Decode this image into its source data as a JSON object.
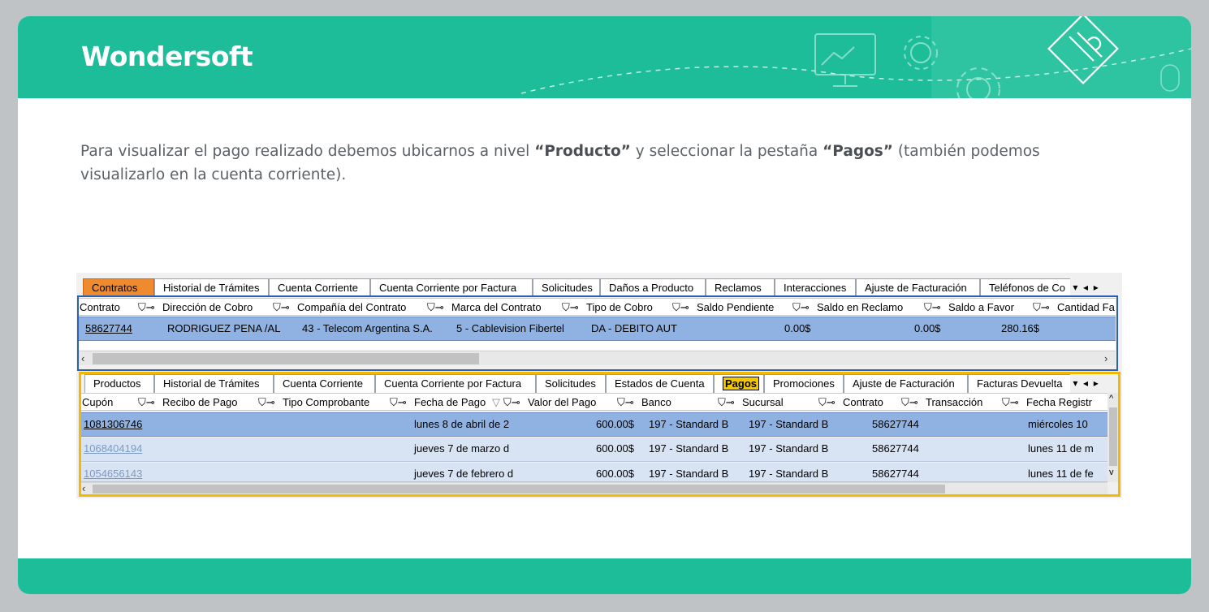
{
  "brand": {
    "name": "Wondersoft"
  },
  "intro": {
    "part1": "Para visualizar el pago realizado debemos ubicarnos a nivel ",
    "bold1": "“Producto”",
    "part2": " y seleccionar la pestaña ",
    "bold2": "“Pagos”",
    "part3": " (también podemos visualizarlo en la cuenta corriente)."
  },
  "colors": {
    "brand_green": "#1dbd9a",
    "orange_tab": "#f08a2f",
    "selected_row": "#8fb2e3",
    "highlight": "#f5b800"
  },
  "top_panel": {
    "tabs": [
      "Contratos",
      "Historial de Trámites",
      "Cuenta Corriente",
      "Cuenta Corriente por Factura",
      "Solicitudes",
      "Daños a Producto",
      "Reclamos",
      "Interacciones",
      "Ajuste de Facturación",
      "Teléfonos de Co"
    ],
    "active_tab": "Contratos",
    "columns": [
      "Contrato",
      "Dirección de Cobro",
      "Compañía del Contrato",
      "Marca del Contrato",
      "Tipo de Cobro",
      "Saldo Pendiente",
      "Saldo en Reclamo",
      "Saldo a Favor",
      "Cantidad Fa"
    ],
    "row": {
      "contrato": "58627744",
      "direccion": "RODRIGUEZ PENA /AL",
      "compania": "43 - Telecom Argentina S.A.",
      "marca": "5 - Cablevision Fibertel",
      "tipo": "DA - DEBITO AUT",
      "saldo_pendiente": "0.00$",
      "saldo_reclamo": "0.00$",
      "saldo_favor": "280.16$"
    }
  },
  "bottom_panel": {
    "tabs": [
      "Productos",
      "Historial de Trámites",
      "Cuenta Corriente",
      "Cuenta Corriente por Factura",
      "Solicitudes",
      "Estados de Cuenta",
      "Pagos",
      "Promociones",
      "Ajuste de Facturación",
      "Facturas Devuelta"
    ],
    "active_tab": "Pagos",
    "columns": [
      "Cupón",
      "Recibo de Pago",
      "Tipo Comprobante",
      "Fecha de Pago",
      "Valor del Pago",
      "Banco",
      "Sucursal",
      "Contrato",
      "Transacción",
      "Fecha Registr"
    ],
    "rows": [
      {
        "cupon": "1081306746",
        "fecha": "lunes 8 de abril de 2",
        "valor": "600.00$",
        "banco": "197 - Standard B",
        "sucursal": "197 - Standard B",
        "contrato": "58627744",
        "registro": "miércoles 10"
      },
      {
        "cupon": "1068404194",
        "fecha": "jueves 7 de marzo d",
        "valor": "600.00$",
        "banco": "197 - Standard B",
        "sucursal": "197 - Standard B",
        "contrato": "58627744",
        "registro": "lunes 11 de m"
      },
      {
        "cupon": "1054656143",
        "fecha": "jueves 7 de febrero d",
        "valor": "600.00$",
        "banco": "197 - Standard B",
        "sucursal": "197 - Standard B",
        "contrato": "58627744",
        "registro": "lunes 11 de fe"
      }
    ]
  }
}
